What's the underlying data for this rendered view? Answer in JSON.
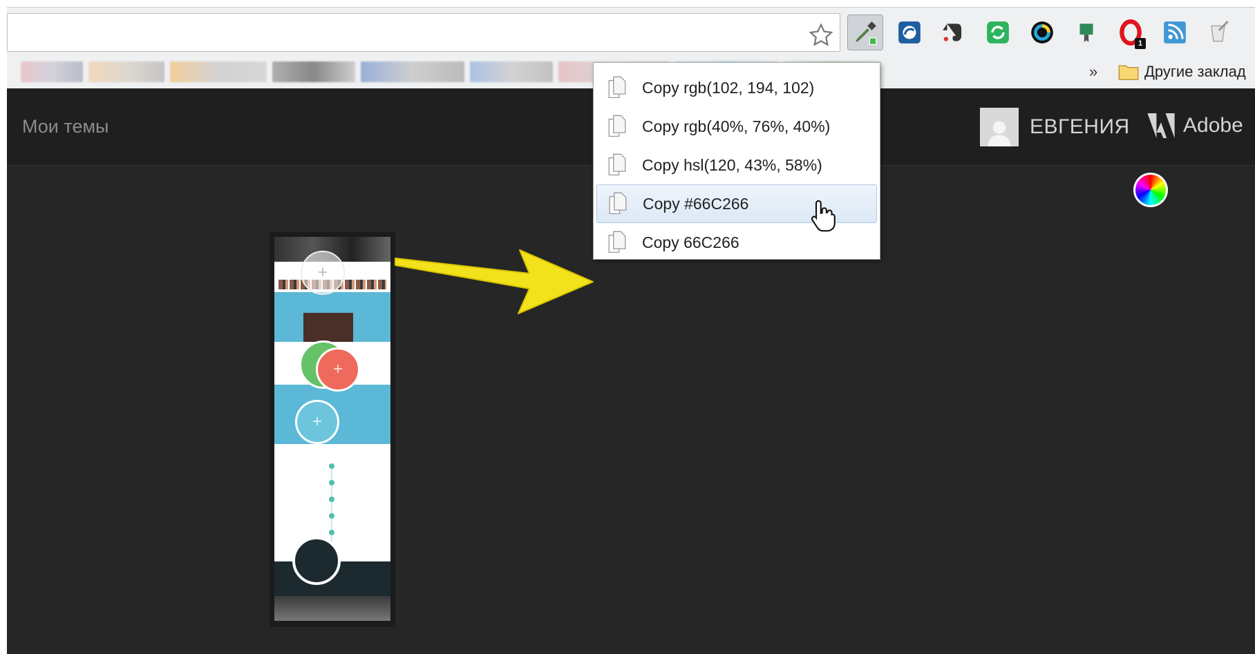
{
  "browser": {
    "extensions": [
      {
        "icon": "eyedropper-icon",
        "active": true
      },
      {
        "icon": "color-picker-icon"
      },
      {
        "icon": "evernote-icon"
      },
      {
        "icon": "sync-icon"
      },
      {
        "icon": "color-wheel-icon"
      },
      {
        "icon": "shopping-bag-icon"
      },
      {
        "icon": "opera-icon",
        "badge": "1"
      },
      {
        "icon": "rss-icon"
      },
      {
        "icon": "clipboard-icon"
      }
    ],
    "bookmarks": {
      "more_label": "»",
      "other_bookmarks_label": "Другие заклад"
    }
  },
  "page": {
    "my_themes_label": "Мои темы",
    "user_name": "ЕВГЕНИЯ",
    "adobe_label": "Adobe"
  },
  "context_menu": {
    "items": [
      {
        "label": "Copy rgb(102, 194, 102)"
      },
      {
        "label": "Copy rgb(40%, 76%, 40%)"
      },
      {
        "label": "Copy hsl(120, 43%, 58%)"
      },
      {
        "label": "Copy #66C266",
        "hovered": true
      },
      {
        "label": "Copy 66C266"
      }
    ]
  },
  "colors": {
    "picked": "#66C266",
    "page_background": "#262626",
    "arrow": "#F2E21B"
  }
}
